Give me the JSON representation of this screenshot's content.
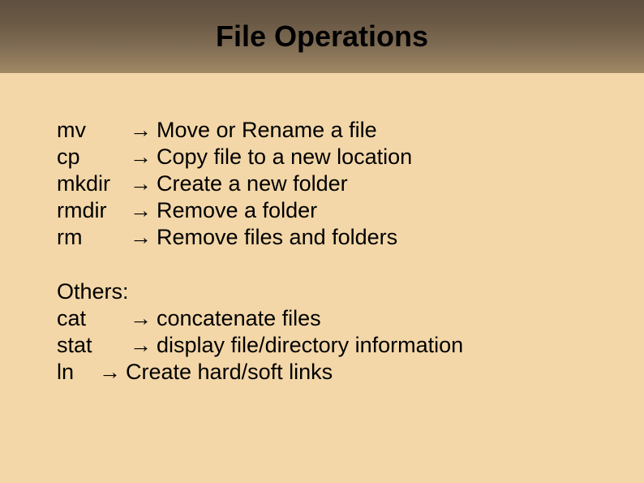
{
  "title": "File Operations",
  "arrow": "→",
  "commands": [
    {
      "cmd": "mv",
      "desc": "Move or Rename a file"
    },
    {
      "cmd": "cp",
      "desc": "Copy file to a new location"
    },
    {
      "cmd": "mkdir",
      "desc": "Create a new folder"
    },
    {
      "cmd": "rmdir",
      "desc": "Remove a folder"
    },
    {
      "cmd": "rm",
      "desc": "Remove files and folders"
    }
  ],
  "others_label": "Others:",
  "others": [
    {
      "cmd": "cat",
      "desc": "concatenate files"
    },
    {
      "cmd": "stat",
      "desc": "display file/directory information"
    }
  ],
  "ln": {
    "cmd": "ln",
    "desc": "Create hard/soft links"
  }
}
